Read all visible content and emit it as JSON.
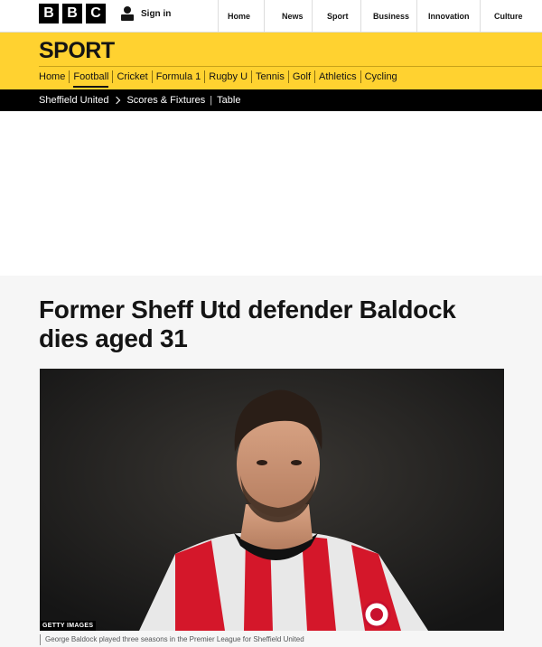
{
  "brand": {
    "letters": [
      "B",
      "B",
      "C"
    ]
  },
  "account": {
    "signin_label": "Sign in",
    "icon": "person-icon"
  },
  "global_nav": [
    {
      "label": "Home"
    },
    {
      "label": "News"
    },
    {
      "label": "Sport"
    },
    {
      "label": "Business"
    },
    {
      "label": "Innovation"
    },
    {
      "label": "Culture"
    }
  ],
  "sport": {
    "title": "SPORT",
    "accent_color": "#ffd230",
    "nav": [
      "Home",
      "Football",
      "Cricket",
      "Formula 1",
      "Rugby U",
      "Tennis",
      "Golf",
      "Athletics",
      "Cycling"
    ],
    "active_item": "Football"
  },
  "section_nav": {
    "team": "Sheffield United",
    "links": [
      "Scores & Fixtures",
      "Table"
    ]
  },
  "article": {
    "headline": "Former Sheff Utd defender Baldock dies aged 31",
    "image_credit": "GETTY IMAGES",
    "caption": "George Baldock played three seasons in the Premier League for Sheffield United"
  }
}
